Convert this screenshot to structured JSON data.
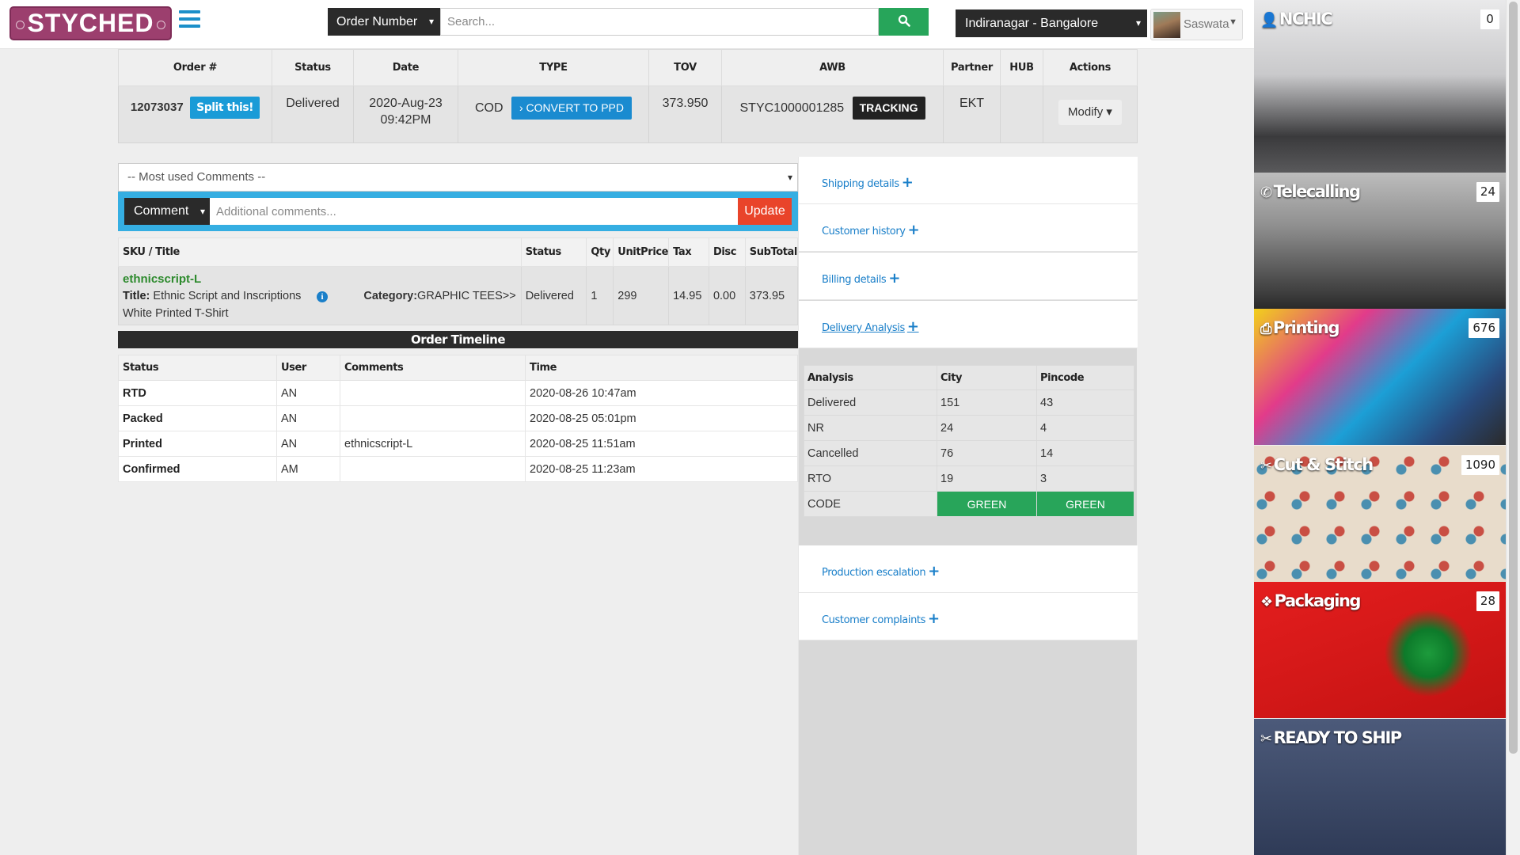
{
  "header": {
    "logo_text": "STYCHED",
    "search_type": "Order Number",
    "search_placeholder": "Search...",
    "location": "Indiranagar - Bangalore",
    "user_name": "Saswata"
  },
  "order": {
    "columns": [
      "Order #",
      "Status",
      "Date",
      "TYPE",
      "TOV",
      "AWB",
      "Partner",
      "HUB",
      "Actions"
    ],
    "order_number": "12073037",
    "split_label": "Split this!",
    "status": "Delivered",
    "date_line1": "2020-Aug-23",
    "date_line2": "09:42PM",
    "type": "COD",
    "convert_label": "› CONVERT TO PPD",
    "tov": "373.950",
    "awb": "STYC1000001285",
    "tracking_label": "TRACKING",
    "partner": "EKT",
    "hub": "",
    "modify_label": "Modify ▾"
  },
  "comments": {
    "select_placeholder": "-- Most used Comments --",
    "comment_type": "Comment",
    "input_placeholder": "Additional comments...",
    "update_label": "Update"
  },
  "sku": {
    "columns": [
      "SKU / Title",
      "Status",
      "Qty",
      "UnitPrice",
      "Tax",
      "Disc",
      "SubTotal"
    ],
    "code": "ethnicscript-L",
    "title_label": "Title:",
    "title": "Ethnic Script and Inscriptions",
    "subtitle": "White Printed T-Shirt",
    "category_label": "Category:",
    "category": "GRAPHIC TEES>>",
    "status": "Delivered",
    "qty": "1",
    "unit_price": "299",
    "tax": "14.95",
    "disc": "0.00",
    "subtotal": "373.95"
  },
  "timeline": {
    "heading": "Order Timeline",
    "columns": [
      "Status",
      "User",
      "Comments",
      "Time"
    ],
    "rows": [
      {
        "status": "RTD",
        "user": "AN",
        "comment": "",
        "time": "2020-08-26 10:47am"
      },
      {
        "status": "Packed",
        "user": "AN",
        "comment": "",
        "time": "2020-08-25 05:01pm"
      },
      {
        "status": "Printed",
        "user": "AN",
        "comment": "ethnicscript-L",
        "time": "2020-08-25 11:51am"
      },
      {
        "status": "Confirmed",
        "user": "AM",
        "comment": "",
        "time": "2020-08-25 11:23am"
      }
    ]
  },
  "panel": {
    "shipping": "Shipping details",
    "customer_history": "Customer history",
    "billing": "Billing details",
    "delivery_analysis": "Delivery Analysis",
    "production_escalation": "Production escalation",
    "customer_complaints": "Customer complaints",
    "analysis": {
      "columns": [
        "Analysis",
        "City",
        "Pincode"
      ],
      "rows": [
        {
          "label": "Delivered",
          "city": "151",
          "pincode": "43"
        },
        {
          "label": "NR",
          "city": "24",
          "pincode": "4"
        },
        {
          "label": "Cancelled",
          "city": "76",
          "pincode": "14"
        },
        {
          "label": "RTO",
          "city": "19",
          "pincode": "3"
        }
      ],
      "code_label": "CODE",
      "code_city": "GREEN",
      "code_pincode": "GREEN"
    }
  },
  "tiles": [
    {
      "label": "NCHIC",
      "count": "0",
      "icon": "user-icon"
    },
    {
      "label": "Telecalling",
      "count": "24",
      "icon": "phone-icon"
    },
    {
      "label": "Printing",
      "count": "676",
      "icon": "printer-icon"
    },
    {
      "label": "Cut & Stitch",
      "count": "1090",
      "icon": "scissors-icon"
    },
    {
      "label": "Packaging",
      "count": "28",
      "icon": "cubes-icon"
    },
    {
      "label": "READY TO SHIP",
      "count": "",
      "icon": "scissors-icon"
    }
  ],
  "colors": {
    "brand": "#9c3f6e",
    "accent_blue": "#1a9bd7",
    "success_green": "#28a55a",
    "danger_red": "#e9442a"
  }
}
